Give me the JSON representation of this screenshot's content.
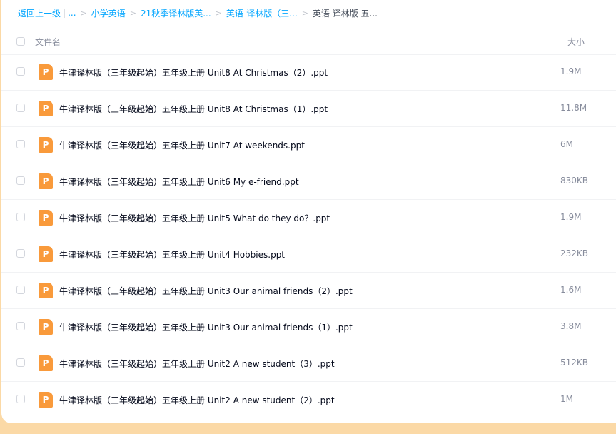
{
  "breadcrumb": {
    "back": "返回上一级",
    "back_suffix": "...",
    "items": [
      "小学英语",
      "21秋季译林版英...",
      "英语-译林版（三..."
    ],
    "current": "英语 译林版 五..."
  },
  "list_header": {
    "name_label": "文件名",
    "size_label": "大小"
  },
  "files": [
    {
      "name": "牛津译林版（三年级起始）五年级上册 Unit8 At Christmas（2）.ppt",
      "size": "1.9M"
    },
    {
      "name": "牛津译林版（三年级起始）五年级上册 Unit8 At Christmas（1）.ppt",
      "size": "11.8M"
    },
    {
      "name": "牛津译林版（三年级起始）五年级上册 Unit7 At weekends.ppt",
      "size": "6M"
    },
    {
      "name": "牛津译林版（三年级起始）五年级上册 Unit6 My e-friend.ppt",
      "size": "830KB"
    },
    {
      "name": "牛津译林版（三年级起始）五年级上册 Unit5 What do they do？.ppt",
      "size": "1.9M"
    },
    {
      "name": "牛津译林版（三年级起始）五年级上册 Unit4 Hobbies.ppt",
      "size": "232KB"
    },
    {
      "name": "牛津译林版（三年级起始）五年级上册 Unit3 Our animal friends（2）.ppt",
      "size": "1.6M"
    },
    {
      "name": "牛津译林版（三年级起始）五年级上册 Unit3 Our animal friends（1）.ppt",
      "size": "3.8M"
    },
    {
      "name": "牛津译林版（三年级起始）五年级上册 Unit2 A new student（3）.ppt",
      "size": "512KB"
    },
    {
      "name": "牛津译林版（三年级起始）五年级上册 Unit2 A new student（2）.ppt",
      "size": "1M"
    }
  ],
  "icons": {
    "file_type": "ppt-file-icon"
  },
  "colors": {
    "link": "#06a7ff",
    "ppt_icon": "#f99a3b",
    "page_background": "#fbd9a6"
  }
}
